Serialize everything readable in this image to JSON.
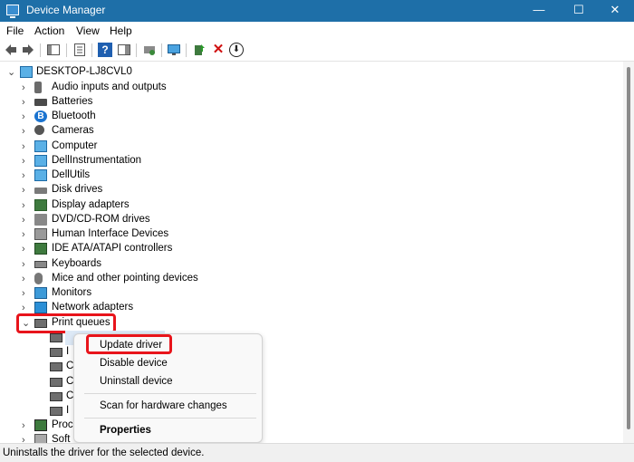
{
  "window": {
    "title": "Device Manager",
    "controls": {
      "minimize": "—",
      "maximize": "☐",
      "close": "✕"
    }
  },
  "menu": [
    "File",
    "Action",
    "View",
    "Help"
  ],
  "toolbar": {
    "icons": [
      "back-arrow-icon",
      "forward-arrow-icon",
      "show-hide-console-tree-icon",
      "properties-icon",
      "help-icon",
      "action-pane-icon",
      "scan-hardware-icon",
      "monitor-icon",
      "update-driver-icon",
      "uninstall-icon",
      "download-icon"
    ],
    "uninstall_glyph": "✕",
    "download_glyph": "⬇",
    "help_glyph": "?"
  },
  "tree": {
    "root": "DESKTOP-LJ8CVL0",
    "categories": [
      {
        "label": "Audio inputs and outputs",
        "icon": "speaker-icon"
      },
      {
        "label": "Batteries",
        "icon": "battery-icon"
      },
      {
        "label": "Bluetooth",
        "icon": "bluetooth-icon"
      },
      {
        "label": "Cameras",
        "icon": "camera-icon"
      },
      {
        "label": "Computer",
        "icon": "computer-icon"
      },
      {
        "label": "DellInstrumentation",
        "icon": "dell-instrumentation-icon"
      },
      {
        "label": "DellUtils",
        "icon": "dell-utils-icon"
      },
      {
        "label": "Disk drives",
        "icon": "disk-drive-icon"
      },
      {
        "label": "Display adapters",
        "icon": "display-adapter-icon"
      },
      {
        "label": "DVD/CD-ROM drives",
        "icon": "dvd-icon"
      },
      {
        "label": "Human Interface Devices",
        "icon": "hid-icon"
      },
      {
        "label": "IDE ATA/ATAPI controllers",
        "icon": "ide-controller-icon"
      },
      {
        "label": "Keyboards",
        "icon": "keyboard-icon"
      },
      {
        "label": "Mice and other pointing devices",
        "icon": "mouse-icon"
      },
      {
        "label": "Monitors",
        "icon": "monitor-icon"
      },
      {
        "label": "Network adapters",
        "icon": "network-adapter-icon"
      },
      {
        "label": "Print queues",
        "icon": "printer-icon",
        "expanded": true
      }
    ],
    "print_queue_children": [
      "",
      "I",
      "C",
      "C",
      "C",
      "I"
    ],
    "after": [
      {
        "label": "Proc",
        "icon": "processor-icon"
      },
      {
        "label": "Soft",
        "icon": "software-icon"
      }
    ],
    "expand_glyph": "›",
    "collapse_glyph": "⌄"
  },
  "context_menu": {
    "items": [
      "Update driver",
      "Disable device",
      "Uninstall device",
      "Scan for hardware changes",
      "Properties"
    ]
  },
  "status": "Uninstalls the driver for the selected device.",
  "colors": {
    "titlebar": "#1e6fa8",
    "highlight": "#e8141b"
  }
}
